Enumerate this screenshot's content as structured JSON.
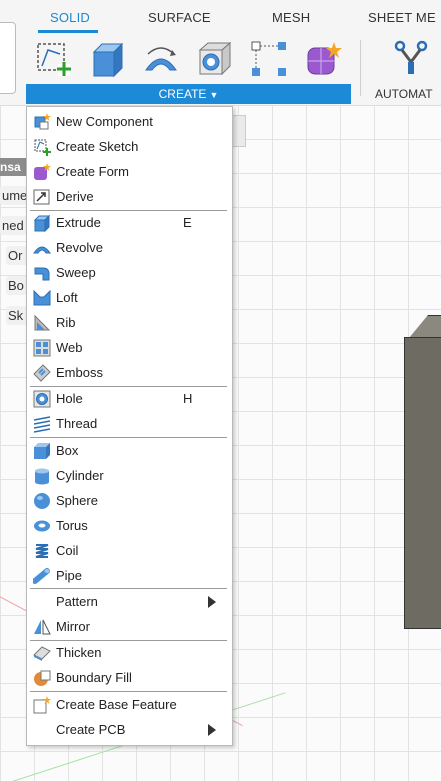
{
  "toolbar": {
    "tabs": [
      "SOLID",
      "SURFACE",
      "MESH",
      "SHEET ME"
    ],
    "create_label": "CREATE",
    "automate_label": "AUTOMAT",
    "tool_icons": [
      "create-sketch-icon",
      "extrude-icon",
      "revolve-icon",
      "hole-icon",
      "pattern-icon",
      "create-form-icon"
    ]
  },
  "browser": {
    "header": "nsa",
    "items": [
      "ume",
      "ned",
      "Or",
      "Bo",
      "Sk"
    ]
  },
  "menu": {
    "items": [
      {
        "label": "New Component",
        "icon": "new-component-icon"
      },
      {
        "label": "Create Sketch",
        "icon": "create-sketch-icon"
      },
      {
        "label": "Create Form",
        "icon": "create-form-icon"
      },
      {
        "label": "Derive",
        "icon": "derive-icon"
      },
      {
        "label": "Extrude",
        "icon": "extrude-icon",
        "shortcut": "E"
      },
      {
        "label": "Revolve",
        "icon": "revolve-icon"
      },
      {
        "label": "Sweep",
        "icon": "sweep-icon"
      },
      {
        "label": "Loft",
        "icon": "loft-icon"
      },
      {
        "label": "Rib",
        "icon": "rib-icon"
      },
      {
        "label": "Web",
        "icon": "web-icon"
      },
      {
        "label": "Emboss",
        "icon": "emboss-icon"
      },
      {
        "label": "Hole",
        "icon": "hole-icon",
        "shortcut": "H"
      },
      {
        "label": "Thread",
        "icon": "thread-icon"
      },
      {
        "label": "Box",
        "icon": "box-icon"
      },
      {
        "label": "Cylinder",
        "icon": "cylinder-icon"
      },
      {
        "label": "Sphere",
        "icon": "sphere-icon"
      },
      {
        "label": "Torus",
        "icon": "torus-icon"
      },
      {
        "label": "Coil",
        "icon": "coil-icon"
      },
      {
        "label": "Pipe",
        "icon": "pipe-icon"
      },
      {
        "label": "Pattern",
        "icon": "",
        "submenu": true
      },
      {
        "label": "Mirror",
        "icon": "mirror-icon"
      },
      {
        "label": "Thicken",
        "icon": "thicken-icon"
      },
      {
        "label": "Boundary Fill",
        "icon": "boundary-fill-icon"
      },
      {
        "label": "Create Base Feature",
        "icon": "create-base-feature-icon"
      },
      {
        "label": "Create PCB",
        "icon": "",
        "submenu": true
      }
    ]
  },
  "colors": {
    "accent": "#1c8ad6",
    "solid_blue": "#4a90d9",
    "body_gray": "#6e6c62"
  }
}
